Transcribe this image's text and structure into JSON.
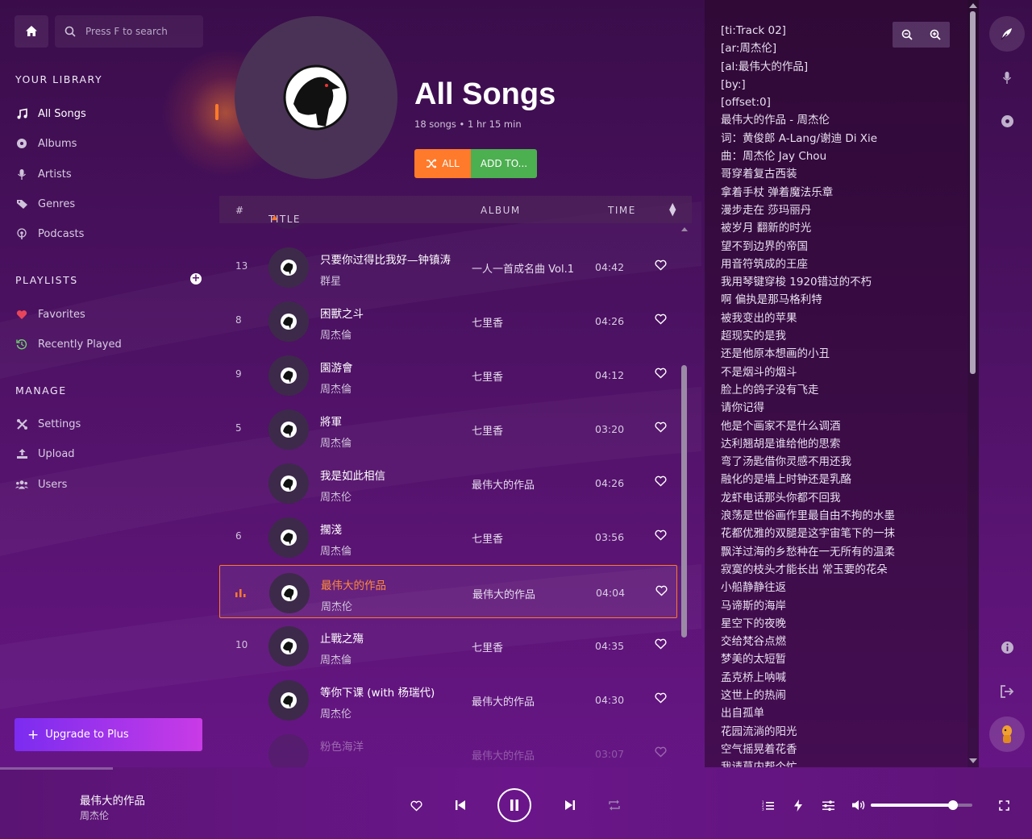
{
  "search": {
    "placeholder": "Press F to search"
  },
  "sidebar": {
    "library_title": "YOUR LIBRARY",
    "library_items": [
      {
        "label": "All Songs",
        "icon": "music-note-icon"
      },
      {
        "label": "Albums",
        "icon": "disc-icon"
      },
      {
        "label": "Artists",
        "icon": "microphone-icon"
      },
      {
        "label": "Genres",
        "icon": "tag-icon"
      },
      {
        "label": "Podcasts",
        "icon": "podcast-icon"
      }
    ],
    "playlists_title": "PLAYLISTS",
    "playlist_items": [
      {
        "label": "Favorites",
        "icon": "heart-icon"
      },
      {
        "label": "Recently Played",
        "icon": "history-icon"
      }
    ],
    "manage_title": "MANAGE",
    "manage_items": [
      {
        "label": "Settings",
        "icon": "settings-icon"
      },
      {
        "label": "Upload",
        "icon": "upload-icon"
      },
      {
        "label": "Users",
        "icon": "users-icon"
      }
    ],
    "upgrade_label": "Upgrade to Plus"
  },
  "header": {
    "title": "All Songs",
    "subtitle": "18 songs • 1 hr 15 min",
    "shuffle_all_label": "ALL",
    "add_to_label": "ADD TO..."
  },
  "table": {
    "col_num": "#",
    "col_title": "TITLE",
    "col_album": "ALBUM",
    "col_time": "TIME",
    "rows": [
      {
        "num": "13",
        "title": "只要你过得比我好—钟镇涛",
        "artist": "群星",
        "album": "一人一首成名曲 Vol.1",
        "time": "04:42"
      },
      {
        "num": "8",
        "title": "困獸之斗",
        "artist": "周杰倫",
        "album": "七里香",
        "time": "04:26"
      },
      {
        "num": "9",
        "title": "園游會",
        "artist": "周杰倫",
        "album": "七里香",
        "time": "04:12"
      },
      {
        "num": "5",
        "title": "將軍",
        "artist": "周杰倫",
        "album": "七里香",
        "time": "03:20"
      },
      {
        "num": "",
        "title": "我是如此相信",
        "artist": "周杰伦",
        "album": "最伟大的作品",
        "time": "04:26"
      },
      {
        "num": "6",
        "title": "擱淺",
        "artist": "周杰倫",
        "album": "七里香",
        "time": "03:56"
      },
      {
        "num": "",
        "title": "最伟大的作品",
        "artist": "周杰伦",
        "album": "最伟大的作品",
        "time": "04:04",
        "current": true
      },
      {
        "num": "10",
        "title": "止戰之殤",
        "artist": "周杰倫",
        "album": "七里香",
        "time": "04:35"
      },
      {
        "num": "",
        "title": "等你下课 (with 杨瑞代)",
        "artist": "周杰伦",
        "album": "最伟大的作品",
        "time": "04:30"
      },
      {
        "num": "",
        "title": "粉色海洋",
        "artist": "",
        "album": "最伟大的作品",
        "time": "03:07"
      }
    ]
  },
  "lyrics": [
    "[ti:Track 02]",
    "[ar:周杰伦]",
    "[al:最伟大的作品]",
    "[by:]",
    "[offset:0]",
    "最伟大的作品 - 周杰伦",
    "词：黄俊郎 A-Lang/谢迪 Di Xie",
    "曲：周杰伦 Jay Chou",
    "哥穿着复古西装",
    "拿着手杖 弹着魔法乐章",
    "漫步走在 莎玛丽丹",
    "被岁月 翻新的时光",
    "望不到边界的帝国",
    "用音符筑成的王座",
    "我用琴键穿梭 1920错过的不朽",
    "啊 偏执是那马格利特",
    "被我变出的苹果",
    "超现实的是我",
    "还是他原本想画的小丑",
    "不是烟斗的烟斗",
    "脸上的鸽子没有飞走",
    "请你记得",
    "他是个画家不是什么调酒",
    "达利翘胡是谁给他的思索",
    "弯了汤匙借你灵感不用还我",
    "融化的是墙上时钟还是乳酪",
    "龙虾电话那头你都不回我",
    "浪荡是世俗画作里最自由不拘的水墨",
    "花都优雅的双腿是这宇宙笔下的一抹",
    "飘洋过海的乡愁种在一无所有的温柔",
    "寂寞的枝头才能长出 常玉要的花朵",
    "小船静静往返",
    "马谛斯的海岸",
    "星空下的夜晚",
    "交给梵谷点燃",
    "梦美的太短暂",
    "孟克桥上呐喊",
    "这世上的热闹",
    "出自孤单",
    "花园流淌的阳光",
    "空气摇晃着花香",
    "我请莫内帮个忙"
  ],
  "player": {
    "title": "最伟大的作品",
    "artist": "周杰伦",
    "volume": 0.8
  },
  "colors": {
    "accent": "#ff7a2a",
    "add_button": "#4caf50",
    "upgrade_start": "#7b2cf0",
    "upgrade_end": "#c93be6"
  }
}
